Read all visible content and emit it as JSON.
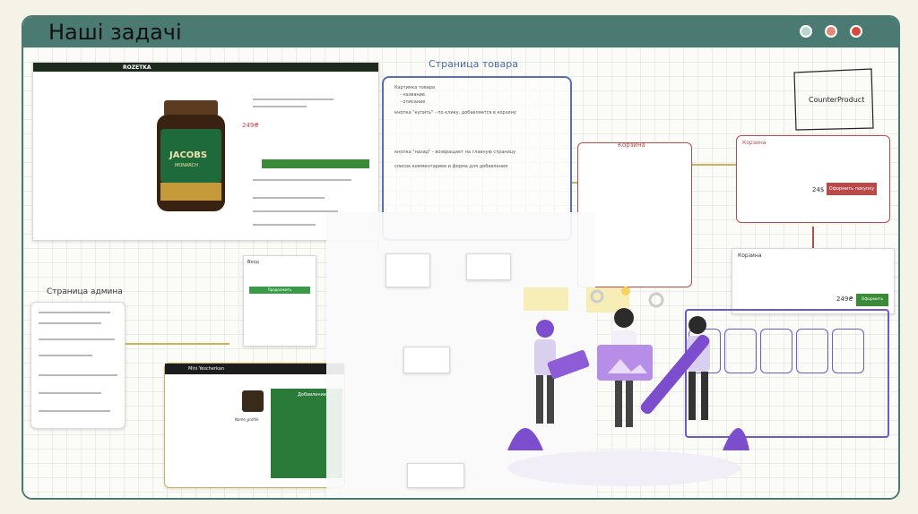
{
  "slide": {
    "title": "Наші задачі",
    "dot_colors": [
      "#b7d7c9",
      "#e08a7b",
      "#d44a3c"
    ]
  },
  "board": {
    "rozetka": {
      "logo": "ROZETKA",
      "brand": "JACOBS",
      "sub": "MONARCH",
      "price": "249₴"
    },
    "product_page": {
      "heading": "Страница товара",
      "items": [
        "Картинка товара",
        "- название",
        "- описание",
        "кнопка \"купить\" - по клику, добавляется в корзину",
        "кнопка \"назад\" - возвращает на главную страницу",
        "список комментариев и форма для добавления"
      ]
    },
    "cart": {
      "heading": "Корзина",
      "summary": "Корзина",
      "total": "24$",
      "order_button": "Оформить покупку",
      "cart_card_title": "Корзина",
      "cart_card_total": "249₴",
      "cart_card_button": "Оформить заказ"
    },
    "counter": {
      "label": "CounterProduct"
    },
    "admin": {
      "heading": "Страница админа"
    },
    "login": {
      "title": "Вход",
      "button": "Продолжить"
    },
    "admin_ui": {
      "header": "Mini Yescherkan",
      "profile": "Name_profile",
      "add_label": "Добавление"
    }
  }
}
